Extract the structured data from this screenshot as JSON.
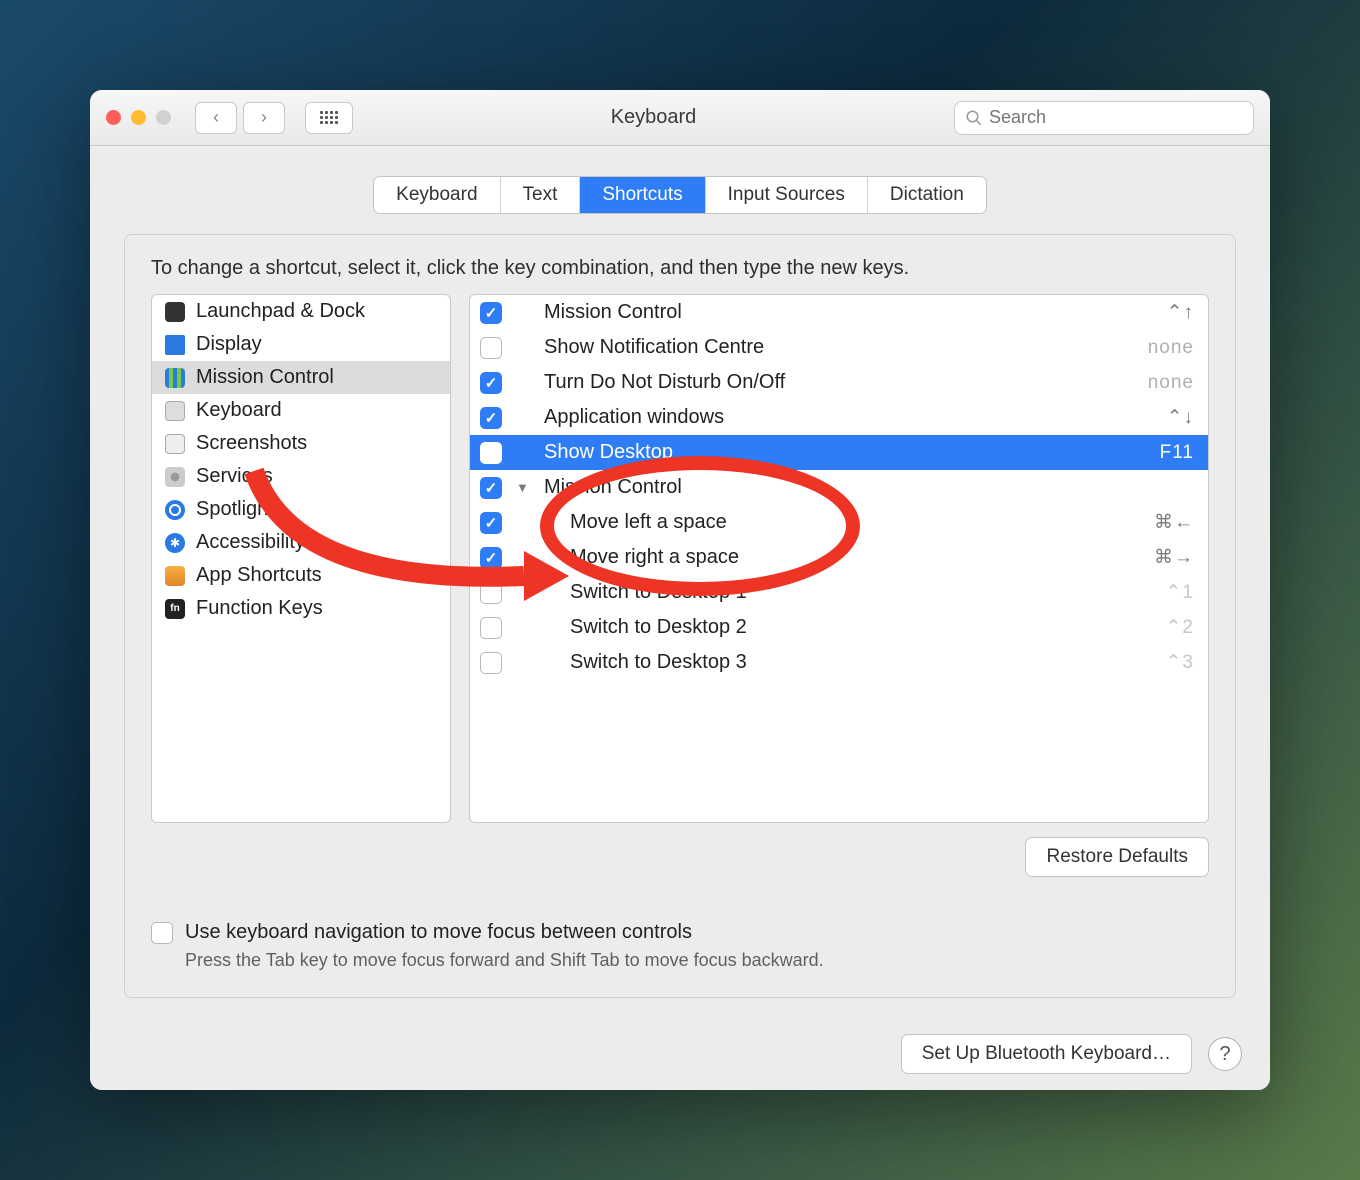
{
  "window": {
    "title": "Keyboard"
  },
  "search": {
    "placeholder": "Search"
  },
  "tabs": [
    "Keyboard",
    "Text",
    "Shortcuts",
    "Input Sources",
    "Dictation"
  ],
  "active_tab": 2,
  "instruction": "To change a shortcut, select it, click the key combination, and then type the new keys.",
  "sidebar": {
    "items": [
      {
        "label": "Launchpad & Dock",
        "icon": "ic-launchpad"
      },
      {
        "label": "Display",
        "icon": "ic-display"
      },
      {
        "label": "Mission Control",
        "icon": "ic-mc",
        "selected": true
      },
      {
        "label": "Keyboard",
        "icon": "ic-kbd"
      },
      {
        "label": "Screenshots",
        "icon": "ic-shot"
      },
      {
        "label": "Services",
        "icon": "ic-svc"
      },
      {
        "label": "Spotlight",
        "icon": "ic-spot"
      },
      {
        "label": "Accessibility",
        "icon": "ic-acc"
      },
      {
        "label": "App Shortcuts",
        "icon": "ic-app"
      },
      {
        "label": "Function Keys",
        "icon": "ic-fn",
        "text_icon": "fn"
      }
    ]
  },
  "shortcuts": [
    {
      "checked": true,
      "label": "Mission Control",
      "key": "⌃↑",
      "indent": 0
    },
    {
      "checked": false,
      "label": "Show Notification Centre",
      "key": "none",
      "key_none": true,
      "indent": 0
    },
    {
      "checked": true,
      "label": "Turn Do Not Disturb On/Off",
      "key": "none",
      "key_none": true,
      "indent": 0
    },
    {
      "checked": true,
      "label": "Application windows",
      "key": "⌃↓",
      "indent": 0
    },
    {
      "checked": false,
      "label": "Show Desktop",
      "key": "F11",
      "indent": 0,
      "selected": true
    },
    {
      "checked": true,
      "label": "Mission Control",
      "key": "",
      "indent": 0,
      "group": true,
      "expanded": true
    },
    {
      "checked": true,
      "label": "Move left a space",
      "key": "⌘←",
      "indent": 1
    },
    {
      "checked": true,
      "label": "Move right a space",
      "key": "⌘→",
      "indent": 1
    },
    {
      "checked": false,
      "label": "Switch to Desktop 1",
      "key": "⌃1",
      "indent": 1,
      "key_dim": true
    },
    {
      "checked": false,
      "label": "Switch to Desktop 2",
      "key": "⌃2",
      "indent": 1,
      "key_dim": true
    },
    {
      "checked": false,
      "label": "Switch to Desktop 3",
      "key": "⌃3",
      "indent": 1,
      "key_dim": true
    }
  ],
  "restore_btn": "Restore Defaults",
  "kbnav": {
    "label": "Use keyboard navigation to move focus between controls",
    "sub": "Press the Tab key to move focus forward and Shift Tab to move focus backward."
  },
  "footer": {
    "bluetooth_btn": "Set Up Bluetooth Keyboard…"
  }
}
